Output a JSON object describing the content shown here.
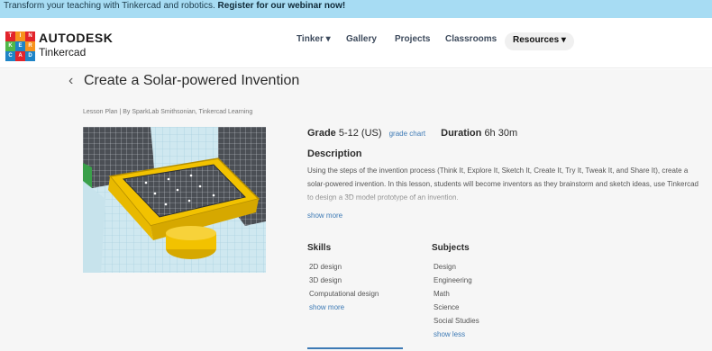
{
  "banner": {
    "text": "Transform your teaching with Tinkercad and robotics.",
    "cta": "Register for our webinar now!"
  },
  "brand": {
    "logo_letters": [
      "T",
      "I",
      "N",
      "K",
      "E",
      "R",
      "C",
      "A",
      "D"
    ],
    "logo_colors": [
      "#e2242b",
      "#f7931d",
      "#e2242b",
      "#51b848",
      "#1f84c6",
      "#f7931d",
      "#1f84c6",
      "#e2242b",
      "#1f84c6"
    ],
    "name_top": "AUTODESK",
    "name_sub": "Tinkercad"
  },
  "nav": {
    "tinker": "Tinker ▾",
    "gallery": "Gallery",
    "projects": "Projects",
    "classrooms": "Classrooms",
    "resources": "Resources ▾"
  },
  "page": {
    "back_glyph": "‹",
    "title": "Create a Solar-powered Invention",
    "breadcrumb": "Lesson Plan | By SparkLab Smithsonian, Tinkercad Learning"
  },
  "details": {
    "grade_label": "Grade",
    "grade_value": "5-12 (US)",
    "grade_chart": "grade chart",
    "duration_label": "Duration",
    "duration_value": "6h 30m",
    "description_title": "Description",
    "description": "Using the steps of the invention process (Think It, Explore It, Sketch It, Create It, Try It, Tweak It, and Share It), create a solar-powered invention. In this lesson, students will become inventors as they brainstorm and sketch ideas, use Tinkercad to design a 3D model prototype of an invention.",
    "show_more": "show more"
  },
  "skills": {
    "title": "Skills",
    "items": [
      "2D design",
      "3D design",
      "Computational design"
    ],
    "more": "show more"
  },
  "subjects": {
    "title": "Subjects",
    "items": [
      "Design",
      "Engineering",
      "Math",
      "Science",
      "Social Studies"
    ],
    "less": "show less"
  }
}
